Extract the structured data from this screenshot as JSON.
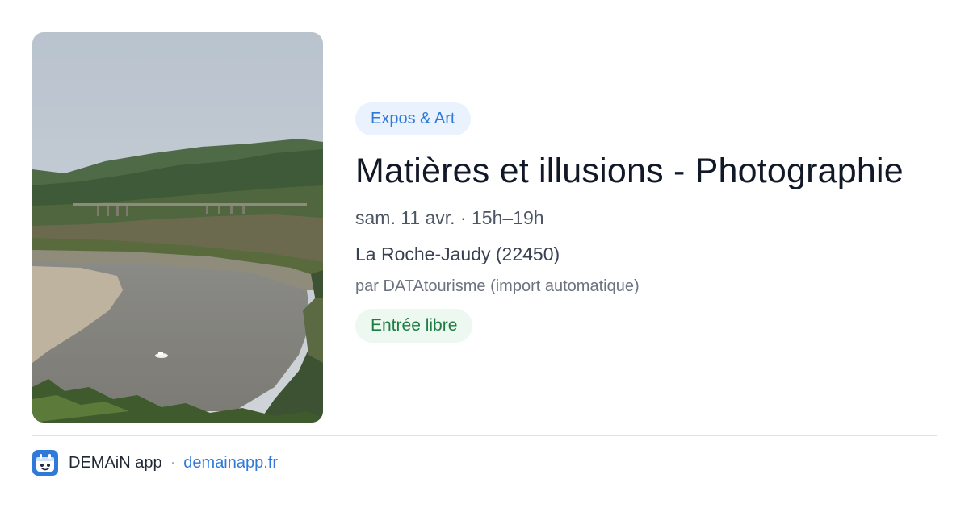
{
  "image": {
    "alt": ""
  },
  "event": {
    "category": "Expos & Art",
    "title": "Matières et illusions - Photographie",
    "date": "sam. 11 avr. · 15h–19h",
    "location": "La Roche-Jaudy (22450)",
    "source": "par DATAtourisme (import automatique)",
    "price": "Entrée libre"
  },
  "footer": {
    "app_name": "DEMAiN app",
    "separator": "·",
    "link": "demainapp.fr"
  },
  "colors": {
    "category_bg": "#e9f2fd",
    "category_text": "#2f7ad9",
    "price_bg": "#ecf8f0",
    "price_text": "#1e7d42",
    "title": "#111827",
    "link": "#2f7ad9"
  }
}
